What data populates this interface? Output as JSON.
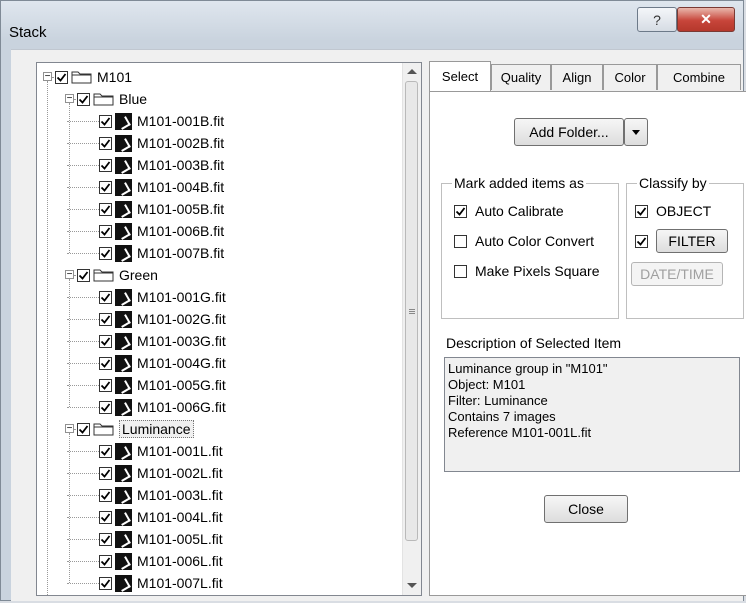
{
  "window": {
    "title": "Stack",
    "help_glyph": "?",
    "close_glyph": "✕"
  },
  "tree": {
    "root": {
      "label": "M101",
      "checked": true
    },
    "groups": [
      {
        "label": "Blue",
        "files": [
          "M101-001B.fit",
          "M101-002B.fit",
          "M101-003B.fit",
          "M101-004B.fit",
          "M101-005B.fit",
          "M101-006B.fit",
          "M101-007B.fit"
        ]
      },
      {
        "label": "Green",
        "files": [
          "M101-001G.fit",
          "M101-002G.fit",
          "M101-003G.fit",
          "M101-004G.fit",
          "M101-005G.fit",
          "M101-006G.fit"
        ]
      },
      {
        "label": "Luminance",
        "selected": true,
        "files": [
          "M101-001L.fit",
          "M101-002L.fit",
          "M101-003L.fit",
          "M101-004L.fit",
          "M101-005L.fit",
          "M101-006L.fit",
          "M101-007L.fit"
        ]
      }
    ]
  },
  "tabs": [
    {
      "label": "Select",
      "active": true
    },
    {
      "label": "Quality"
    },
    {
      "label": "Align"
    },
    {
      "label": "Color"
    },
    {
      "label": "Combine"
    }
  ],
  "select_tab": {
    "add_folder_label": "Add Folder...",
    "mark_group": {
      "title": "Mark added items as",
      "options": [
        {
          "label": "Auto Calibrate",
          "checked": true
        },
        {
          "label": "Auto Color Convert",
          "checked": false
        },
        {
          "label": "Make Pixels Square",
          "checked": false
        }
      ]
    },
    "classify_group": {
      "title": "Classify by",
      "options": [
        {
          "label": "OBJECT",
          "checked": true
        },
        {
          "label": "FILTER",
          "checked": true
        }
      ],
      "date_button": "DATE/TIME"
    },
    "description": {
      "title": "Description of Selected Item",
      "lines": [
        "Luminance group in \"M101\"",
        "Object: M101",
        "Filter: Luminance",
        "Contains 7 images",
        "Reference M101-001L.fit"
      ]
    },
    "close_label": "Close"
  }
}
